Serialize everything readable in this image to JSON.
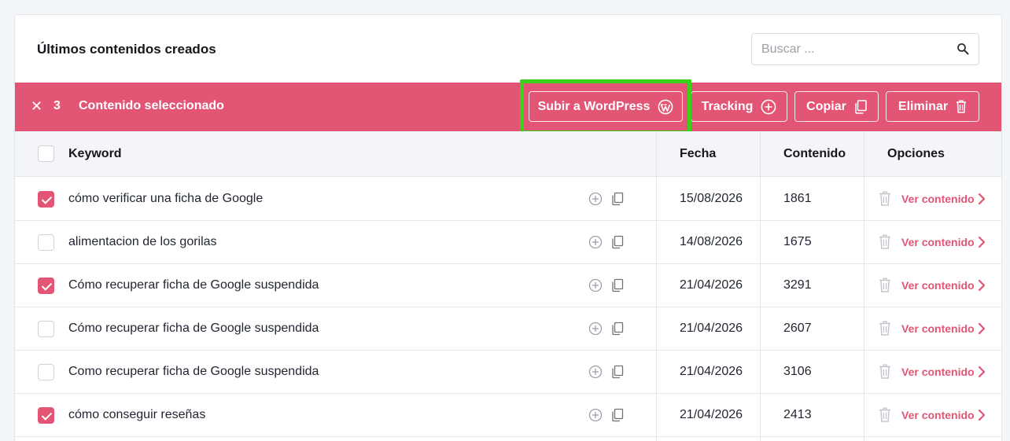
{
  "card": {
    "title": "Últimos contenidos creados"
  },
  "search": {
    "placeholder": "Buscar ..."
  },
  "selection_bar": {
    "close_symbol": "✕",
    "count": "3",
    "label": "Contenido seleccionado",
    "buttons": {
      "wordpress": "Subir a WordPress",
      "tracking": "Tracking",
      "copy": "Copiar",
      "delete": "Eliminar"
    }
  },
  "table": {
    "headers": {
      "keyword": "Keyword",
      "date": "Fecha",
      "content": "Contenido",
      "options": "Opciones"
    },
    "view_label": "Ver contenido",
    "rows": [
      {
        "keyword": "cómo verificar una ficha de Google",
        "date": "15/08/2026",
        "content": "1861",
        "checked": true
      },
      {
        "keyword": "alimentacion de los gorilas",
        "date": "14/08/2026",
        "content": "1675",
        "checked": false
      },
      {
        "keyword": "Cómo recuperar ficha de Google suspendida",
        "date": "21/04/2026",
        "content": "3291",
        "checked": true
      },
      {
        "keyword": "Cómo recuperar ficha de Google suspendida",
        "date": "21/04/2026",
        "content": "2607",
        "checked": false
      },
      {
        "keyword": "Como recuperar ficha de Google suspendida",
        "date": "21/04/2026",
        "content": "3106",
        "checked": false
      },
      {
        "keyword": "cómo conseguir reseñas",
        "date": "21/04/2026",
        "content": "2413",
        "checked": true
      }
    ]
  },
  "colors": {
    "accent": "#e25574",
    "highlight": "#3ad11a",
    "header_bg": "#f4f5f8"
  },
  "icons": [
    "search-icon",
    "close-icon",
    "wordpress-icon",
    "plus-circle-icon",
    "copy-icon",
    "trash-icon",
    "chevron-right-icon",
    "arrow-annotation"
  ]
}
